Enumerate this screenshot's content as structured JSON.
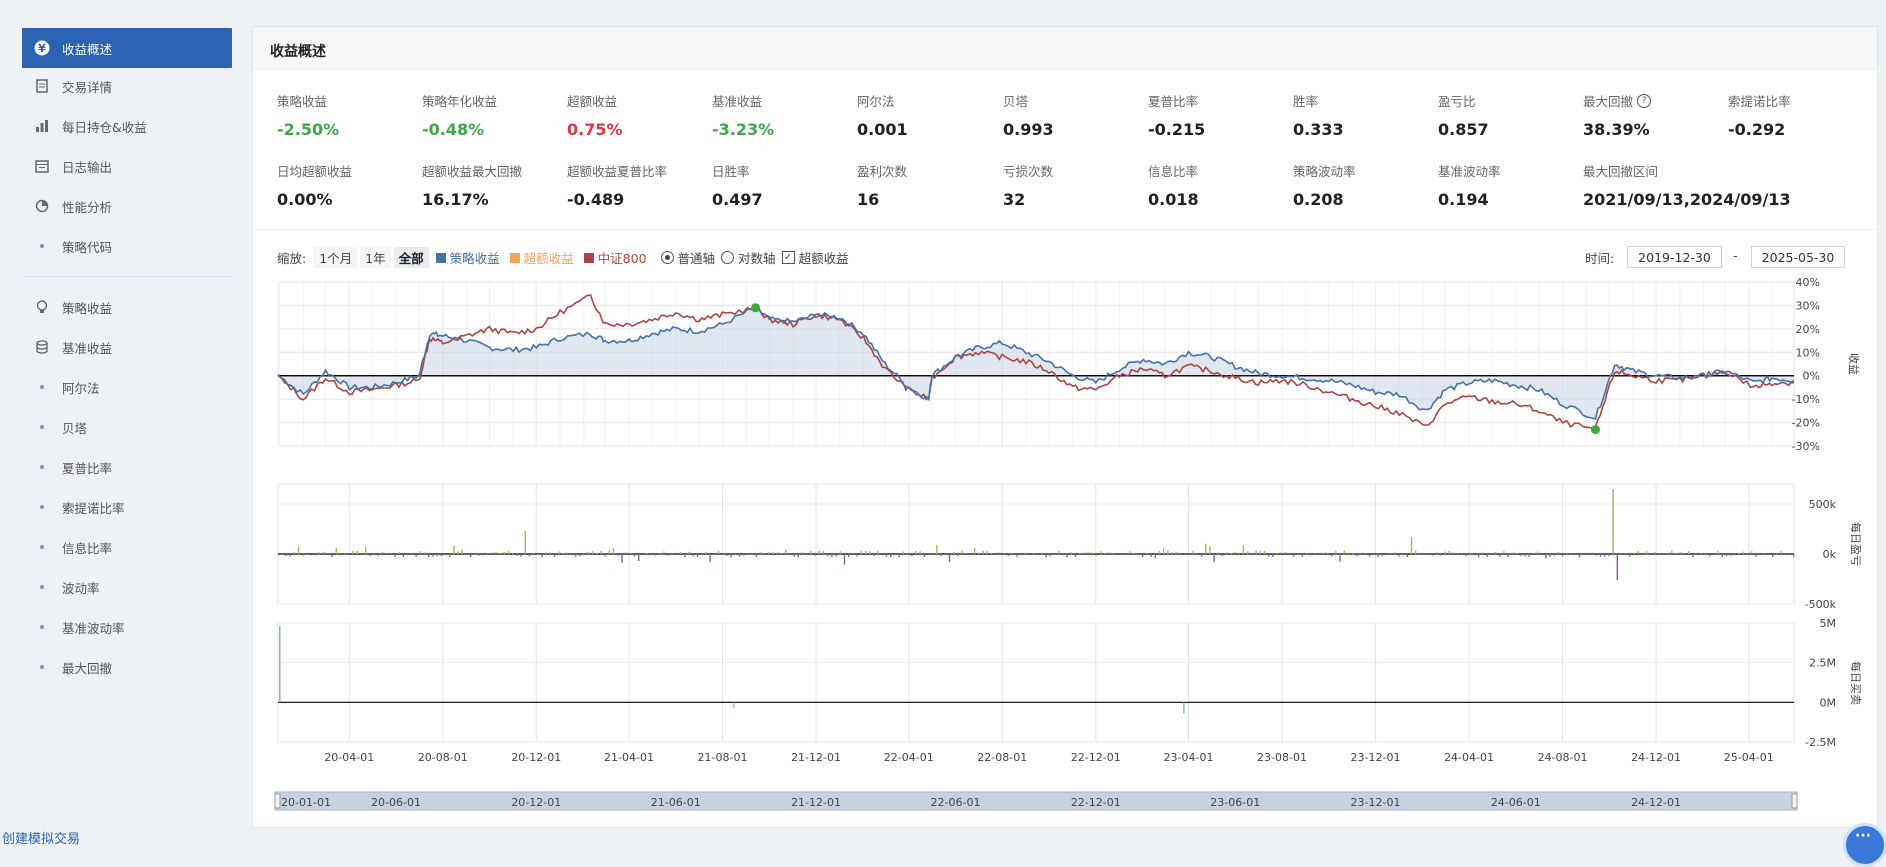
{
  "sidebar": {
    "items": [
      {
        "label": "收益概述",
        "icon": "yen-icon"
      },
      {
        "label": "交易详情",
        "icon": "document-icon"
      },
      {
        "label": "每日持仓&收益",
        "icon": "bar-chart-icon"
      },
      {
        "label": "日志输出",
        "icon": "calendar-icon"
      },
      {
        "label": "性能分析",
        "icon": "pie-icon"
      },
      {
        "label": "策略代码",
        "icon": "dot-icon"
      },
      {
        "label": "策略收益",
        "icon": "bulb-icon"
      },
      {
        "label": "基准收益",
        "icon": "database-icon"
      },
      {
        "label": "阿尔法",
        "icon": "dot-icon"
      },
      {
        "label": "贝塔",
        "icon": "dot-icon"
      },
      {
        "label": "夏普比率",
        "icon": "dot-icon"
      },
      {
        "label": "索提诺比率",
        "icon": "dot-icon"
      },
      {
        "label": "信息比率",
        "icon": "dot-icon"
      },
      {
        "label": "波动率",
        "icon": "dot-icon"
      },
      {
        "label": "基准波动率",
        "icon": "dot-icon"
      },
      {
        "label": "最大回撤",
        "icon": "dot-icon"
      }
    ]
  },
  "panel": {
    "title": "收益概述"
  },
  "metrics_row1": [
    {
      "label": "策略收益",
      "value": "-2.50%",
      "color": "green"
    },
    {
      "label": "策略年化收益",
      "value": "-0.48%",
      "color": "green"
    },
    {
      "label": "超额收益",
      "value": "0.75%",
      "color": "red"
    },
    {
      "label": "基准收益",
      "value": "-3.23%",
      "color": "green"
    },
    {
      "label": "阿尔法",
      "value": "0.001",
      "color": ""
    },
    {
      "label": "贝塔",
      "value": "0.993",
      "color": ""
    },
    {
      "label": "夏普比率",
      "value": "-0.215",
      "color": ""
    },
    {
      "label": "胜率",
      "value": "0.333",
      "color": ""
    },
    {
      "label": "盈亏比",
      "value": "0.857",
      "color": ""
    },
    {
      "label": "最大回撤",
      "value": "38.39%",
      "color": "",
      "help": "?"
    },
    {
      "label": "索提诺比率",
      "value": "-0.292",
      "color": ""
    }
  ],
  "metrics_row2": [
    {
      "label": "日均超额收益",
      "value": "0.00%"
    },
    {
      "label": "超额收益最大回撤",
      "value": "16.17%"
    },
    {
      "label": "超额收益夏普比率",
      "value": "-0.489"
    },
    {
      "label": "日胜率",
      "value": "0.497"
    },
    {
      "label": "盈利次数",
      "value": "16"
    },
    {
      "label": "亏损次数",
      "value": "32"
    },
    {
      "label": "信息比率",
      "value": "0.018"
    },
    {
      "label": "策略波动率",
      "value": "0.208"
    },
    {
      "label": "基准波动率",
      "value": "0.194"
    },
    {
      "label": "最大回撤区间",
      "value": "2021/09/13,2024/09/13"
    }
  ],
  "controls": {
    "zoom_label": "缩放:",
    "zoom_options": [
      "1个月",
      "1年",
      "全部"
    ],
    "zoom_selected": "全部",
    "legend": [
      {
        "name": "策略收益",
        "color": "#4572a7"
      },
      {
        "name": "超额收益",
        "color": "#f7a35c"
      },
      {
        "name": "中证800",
        "color": "#aa4643"
      }
    ],
    "axis_normal": "普通轴",
    "axis_log": "对数轴",
    "excess_checkbox": "超额收益",
    "time_label": "时间:",
    "date_from": "2019-12-30",
    "date_sep": "-",
    "date_to": "2025-05-30"
  },
  "chart_data": [
    {
      "type": "line",
      "title": "",
      "ylabel": "收益",
      "ylim": [
        -30,
        40
      ],
      "yticks": [
        "40%",
        "30%",
        "20%",
        "10%",
        "0%",
        "-10%",
        "-20%",
        "-30%"
      ],
      "x": [
        "2019-12-30",
        "2020-02-01",
        "2020-03-01",
        "2020-04-01",
        "2020-05-01",
        "2020-06-01",
        "2020-07-01",
        "2020-07-15",
        "2020-08-01",
        "2020-09-01",
        "2020-10-01",
        "2020-11-01",
        "2020-12-01",
        "2021-01-01",
        "2021-02-10",
        "2021-03-01",
        "2021-04-01",
        "2021-05-01",
        "2021-06-01",
        "2021-07-01",
        "2021-08-01",
        "2021-09-13",
        "2021-10-01",
        "2021-11-01",
        "2021-12-01",
        "2022-01-01",
        "2022-02-01",
        "2022-03-01",
        "2022-04-01",
        "2022-04-27",
        "2022-05-01",
        "2022-06-01",
        "2022-07-01",
        "2022-08-01",
        "2022-09-01",
        "2022-10-01",
        "2022-11-01",
        "2022-12-01",
        "2023-01-01",
        "2023-02-01",
        "2023-03-01",
        "2023-04-01",
        "2023-05-01",
        "2023-06-01",
        "2023-07-01",
        "2023-08-01",
        "2023-09-01",
        "2023-10-01",
        "2023-11-01",
        "2023-12-01",
        "2024-01-01",
        "2024-02-05",
        "2024-03-01",
        "2024-04-01",
        "2024-05-01",
        "2024-06-01",
        "2024-07-01",
        "2024-08-01",
        "2024-09-13",
        "2024-10-08",
        "2024-11-01",
        "2024-12-01",
        "2025-01-01",
        "2025-02-01",
        "2025-03-01",
        "2025-04-08",
        "2025-05-01",
        "2025-05-30"
      ],
      "series": [
        {
          "name": "策略收益",
          "color": "#4572a7",
          "values": [
            0,
            -8,
            2,
            -5,
            -5,
            -3,
            0,
            18,
            17,
            15,
            12,
            11,
            12,
            16,
            18,
            15,
            15,
            18,
            20,
            19,
            22,
            29,
            24,
            23,
            26,
            25,
            18,
            5,
            -5,
            -10,
            0,
            8,
            12,
            14,
            10,
            6,
            0,
            -3,
            3,
            7,
            5,
            10,
            8,
            4,
            1,
            0,
            -1,
            -2,
            -4,
            -7,
            -8,
            -15,
            -6,
            -3,
            -2,
            -4,
            -6,
            -12,
            -18,
            5,
            2,
            0,
            -1,
            0,
            2,
            -3,
            -1,
            -2
          ]
        },
        {
          "name": "中证800",
          "color": "#aa4643",
          "values": [
            0,
            -10,
            -1,
            -7,
            -6,
            -4,
            -2,
            16,
            14,
            17,
            20,
            18,
            20,
            27,
            34,
            22,
            22,
            24,
            27,
            24,
            26,
            29,
            24,
            22,
            26,
            24,
            16,
            3,
            -6,
            -10,
            -1,
            8,
            10,
            8,
            6,
            2,
            -5,
            -6,
            0,
            3,
            0,
            4,
            2,
            -1,
            -3,
            -2,
            -4,
            -7,
            -10,
            -13,
            -16,
            -22,
            -12,
            -9,
            -11,
            -12,
            -15,
            -20,
            -23,
            2,
            0,
            -2,
            -2,
            0,
            2,
            -5,
            -3,
            -3
          ]
        }
      ]
    },
    {
      "type": "bar",
      "title": "",
      "ylabel": "每日盈亏",
      "ylim": [
        -500000,
        700000
      ],
      "yticks": [
        "500k",
        "0k",
        "-500k"
      ]
    },
    {
      "type": "bar",
      "title": "",
      "ylabel": "每日买卖",
      "ylim": [
        -2500000,
        5000000
      ],
      "yticks": [
        "5M",
        "2.5M",
        "0M",
        "-2.5M"
      ]
    }
  ],
  "xaxis_ticks": [
    "20-04-01",
    "20-08-01",
    "20-12-01",
    "21-04-01",
    "21-08-01",
    "21-12-01",
    "22-04-01",
    "22-08-01",
    "22-12-01",
    "23-04-01",
    "23-08-01",
    "23-12-01",
    "24-04-01",
    "24-08-01",
    "24-12-01",
    "25-04-01"
  ],
  "navigator_ticks": [
    "20-01-01",
    "20-06-01",
    "20-12-01",
    "21-06-01",
    "21-12-01",
    "22-06-01",
    "22-12-01",
    "23-06-01",
    "23-12-01",
    "24-06-01",
    "24-12-01"
  ],
  "footer": {
    "link": "创建模拟交易"
  }
}
